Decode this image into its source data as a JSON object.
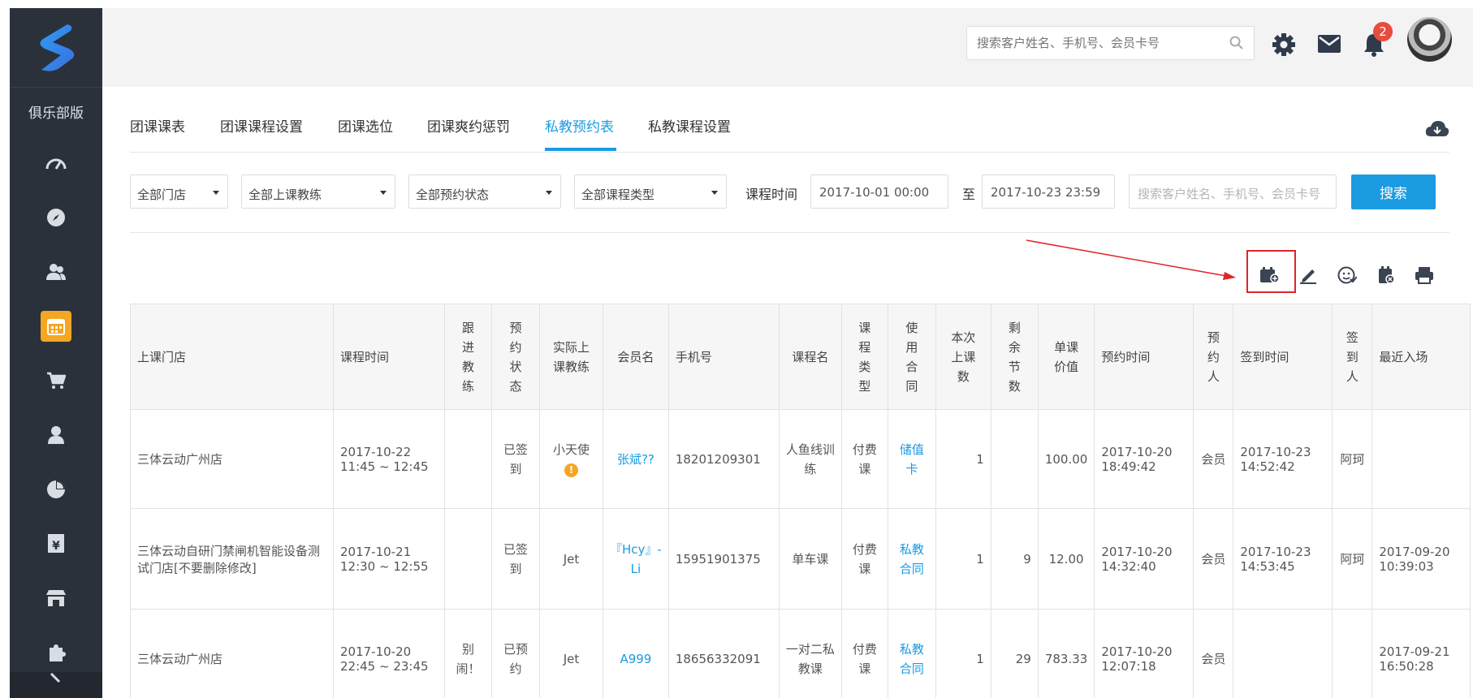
{
  "sidebar": {
    "club_label": "俱乐部版",
    "nav": [
      "dashboard-icon",
      "compass-icon",
      "users-icon",
      "calendar-icon",
      "cart-icon",
      "user-icon",
      "pie-chart-icon",
      "money-icon",
      "store-icon",
      "puzzle-icon"
    ],
    "active": "calendar-icon"
  },
  "header": {
    "search_placeholder": "搜索客户姓名、手机号、会员卡号",
    "notification_count": "2"
  },
  "tabs": [
    {
      "label": "团课课表"
    },
    {
      "label": "团课课程设置"
    },
    {
      "label": "团课选位"
    },
    {
      "label": "团课爽约惩罚"
    },
    {
      "label": "私教预约表",
      "active": true
    },
    {
      "label": "私教课程设置"
    }
  ],
  "filters": {
    "store": "全部门店",
    "coach": "全部上课教练",
    "status": "全部预约状态",
    "course_type": "全部课程类型",
    "time_label": "课程时间",
    "start": "2017-10-01 00:00",
    "to": "至",
    "end": "2017-10-23 23:59",
    "search_placeholder": "搜索客户姓名、手机号、会员卡号",
    "search_button": "搜索"
  },
  "table": {
    "headers": [
      "上课门店",
      "课程时间",
      "跟进教练",
      "预约状态",
      "实际上课教练",
      "会员名",
      "手机号",
      "课程名",
      "课程类型",
      "使用合同",
      "本次上课数",
      "剩余节数",
      "单课价值",
      "预约时间",
      "预约人",
      "签到时间",
      "签到人",
      "最近入场"
    ],
    "rows": [
      {
        "store": "三体云动广州店",
        "time1": "2017-10-22",
        "time2": "11:45 ~ 12:45",
        "follow": "",
        "status": "已签到",
        "coach": "小天使",
        "coach_warn": "!",
        "member": "张斌??",
        "phone": "18201209301",
        "course": "人鱼线训练",
        "type": "付费课",
        "contract": "储值卡",
        "count": "1",
        "remain": "",
        "value": "100.00",
        "book1": "2017-10-20",
        "book2": "18:49:42",
        "booker": "会员",
        "sign1": "2017-10-23",
        "sign2": "14:52:42",
        "signer": "阿珂",
        "last1": "",
        "last2": ""
      },
      {
        "store": "三体云动自研门禁闸机智能设备测试门店[不要删除修改]",
        "time1": "2017-10-21",
        "time2": "12:30 ~ 12:55",
        "follow": "",
        "status": "已签到",
        "coach": "Jet",
        "coach_warn": "",
        "member": "『Hcy』-Li",
        "phone": "15951901375",
        "course": "单车课",
        "type": "付费课",
        "contract": "私教合同",
        "count": "1",
        "remain": "9",
        "value": "12.00",
        "book1": "2017-10-20",
        "book2": "14:32:40",
        "booker": "会员",
        "sign1": "2017-10-23",
        "sign2": "14:53:45",
        "signer": "阿珂",
        "last1": "2017-09-20",
        "last2": "10:39:03"
      },
      {
        "store": "三体云动广州店",
        "time1": "2017-10-20",
        "time2": "22:45 ~ 23:45",
        "follow": "别闹！",
        "status": "已预约",
        "coach": "Jet",
        "coach_warn": "",
        "member": "A999",
        "phone": "18656332091",
        "course": "一对二私教课",
        "type": "付费课",
        "contract": "私教合同",
        "count": "1",
        "remain": "29",
        "value": "783.33",
        "book1": "2017-10-20",
        "book2": "12:07:18",
        "booker": "会员",
        "sign1": "",
        "sign2": "",
        "signer": "",
        "last1": "2017-09-21",
        "last2": "16:50:28"
      }
    ]
  },
  "colors": {
    "accent": "#1a9be2",
    "sidebar": "#2b313b",
    "active_nav": "#f5a623",
    "highlight": "#e0242a"
  }
}
